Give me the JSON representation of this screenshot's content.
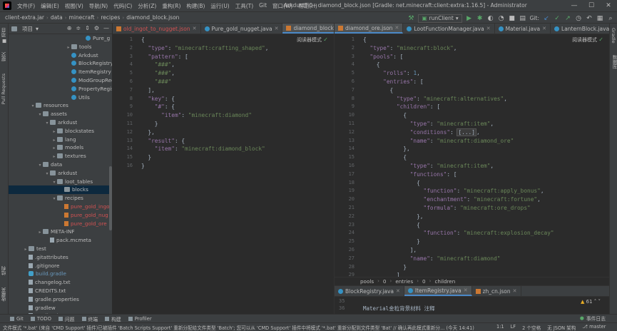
{
  "menu": [
    "文件(F)",
    "编辑(E)",
    "视图(V)",
    "导航(N)",
    "代码(C)",
    "分析(Z)",
    "重构(R)",
    "构建(B)",
    "运行(U)",
    "工具(T)",
    "Git",
    "窗口(W)",
    "帮助(H)"
  ],
  "window_title": "ArkdustTi0 - diamond_block.json [Gradle: net.minecraft:client:extra:1.16.5] - Administrator",
  "breadcrumb": [
    "client-extra.jar",
    "data",
    "minecraft",
    "recipes",
    "diamond_block.json"
  ],
  "run_config": "runClient",
  "git_label": "Git:",
  "project": {
    "title": "项目",
    "rows": [
      {
        "indent": 10,
        "arrow": "",
        "icon": "class",
        "label": "Pure_g",
        "style": ""
      },
      {
        "indent": 8,
        "arrow": "▸",
        "icon": "folder",
        "label": "tools",
        "style": ""
      },
      {
        "indent": 8,
        "arrow": "",
        "icon": "class",
        "label": "Arkdust",
        "style": ""
      },
      {
        "indent": 8,
        "arrow": "",
        "icon": "class",
        "label": "BlockRegistry",
        "style": ""
      },
      {
        "indent": 8,
        "arrow": "",
        "icon": "class",
        "label": "ItemRegistry",
        "style": ""
      },
      {
        "indent": 8,
        "arrow": "",
        "icon": "class",
        "label": "ModGroupRegi",
        "style": ""
      },
      {
        "indent": 8,
        "arrow": "",
        "icon": "class",
        "label": "PropertyRegist",
        "style": ""
      },
      {
        "indent": 8,
        "arrow": "",
        "icon": "class",
        "label": "Utils",
        "style": ""
      },
      {
        "indent": 3,
        "arrow": "▾",
        "icon": "folder",
        "label": "resources",
        "style": ""
      },
      {
        "indent": 4,
        "arrow": "▾",
        "icon": "folder",
        "label": "assets",
        "style": ""
      },
      {
        "indent": 5,
        "arrow": "▾",
        "icon": "folder",
        "label": "arkdust",
        "style": ""
      },
      {
        "indent": 6,
        "arrow": "▸",
        "icon": "folder",
        "label": "blockstates",
        "style": ""
      },
      {
        "indent": 6,
        "arrow": "▸",
        "icon": "folder",
        "label": "lang",
        "style": ""
      },
      {
        "indent": 6,
        "arrow": "▸",
        "icon": "folder",
        "label": "models",
        "style": ""
      },
      {
        "indent": 6,
        "arrow": "▸",
        "icon": "folder",
        "label": "textures",
        "style": ""
      },
      {
        "indent": 4,
        "arrow": "▾",
        "icon": "folder",
        "label": "data",
        "style": ""
      },
      {
        "indent": 5,
        "arrow": "▾",
        "icon": "folder",
        "label": "arkdust",
        "style": ""
      },
      {
        "indent": 6,
        "arrow": "▾",
        "icon": "folder",
        "label": "loot_tables",
        "style": ""
      },
      {
        "indent": 7,
        "arrow": "",
        "icon": "folder",
        "label": "blocks",
        "style": "sel"
      },
      {
        "indent": 6,
        "arrow": "▾",
        "icon": "folder",
        "label": "recipes",
        "style": ""
      },
      {
        "indent": 7,
        "arrow": "",
        "icon": "json",
        "label": "pure_gold_ingo",
        "style": "red"
      },
      {
        "indent": 7,
        "arrow": "",
        "icon": "json",
        "label": "pure_gold_nug",
        "style": "red"
      },
      {
        "indent": 7,
        "arrow": "",
        "icon": "json",
        "label": "pure_gold_ore",
        "style": "red"
      },
      {
        "indent": 4,
        "arrow": "▸",
        "icon": "folder",
        "label": "META-INF",
        "style": ""
      },
      {
        "indent": 5,
        "arrow": "",
        "icon": "file",
        "label": "pack.mcmeta",
        "style": ""
      },
      {
        "indent": 2,
        "arrow": "▸",
        "icon": "folder",
        "label": "test",
        "style": ""
      },
      {
        "indent": 2,
        "arrow": "",
        "icon": "file",
        "label": ".gitattributes",
        "style": ""
      },
      {
        "indent": 2,
        "arrow": "",
        "icon": "file",
        "label": ".gitignore",
        "style": ""
      },
      {
        "indent": 2,
        "arrow": "",
        "icon": "gradle",
        "label": "build.gradle",
        "style": "blue"
      },
      {
        "indent": 2,
        "arrow": "",
        "icon": "file",
        "label": "changelog.txt",
        "style": ""
      },
      {
        "indent": 2,
        "arrow": "",
        "icon": "file",
        "label": "CREDITS.txt",
        "style": ""
      },
      {
        "indent": 2,
        "arrow": "",
        "icon": "file",
        "label": "gradle.properties",
        "style": ""
      },
      {
        "indent": 2,
        "arrow": "",
        "icon": "file",
        "label": "gradlew",
        "style": ""
      },
      {
        "indent": 2,
        "arrow": "",
        "icon": "file",
        "label": "gradlew.bat",
        "style": ""
      },
      {
        "indent": 2,
        "arrow": "",
        "icon": "file",
        "label": "LICENSE.txt",
        "style": ""
      }
    ]
  },
  "left_editor": {
    "tabs": [
      {
        "label": "old_ingot_to_nugget.json",
        "icon": "j",
        "active": false,
        "red": true
      },
      {
        "label": "Pure_gold_nugget.java",
        "icon": "c",
        "active": false,
        "red": false
      },
      {
        "label": "diamond_block.json",
        "icon": "j",
        "active": true,
        "red": false
      }
    ],
    "reader_mode": "阅读器模式",
    "lines": [
      "{",
      "  \"type\": \"minecraft:crafting_shaped\",",
      "  \"pattern\": [",
      "    \"###\",",
      "    \"###\",",
      "    \"###\"",
      "  ],",
      "  \"key\": {",
      "    \"#\": {",
      "      \"item\": \"minecraft:diamond\"",
      "    }",
      "  },",
      "  \"result\": {",
      "    \"item\": \"minecraft:diamond_block\"",
      "  }",
      "}"
    ]
  },
  "right_editor": {
    "tabs": [
      {
        "label": "diamond_ore.json",
        "icon": "j",
        "active": true
      },
      {
        "label": "LootFunctionManager.java",
        "icon": "c",
        "active": false
      },
      {
        "label": "Material.java",
        "icon": "c",
        "active": false
      },
      {
        "label": "LanternBlock.java",
        "icon": "c",
        "active": false
      }
    ],
    "reader_mode": "阅读器模式",
    "line_numbers": [
      "1",
      "2",
      "3",
      "4",
      "5",
      "6",
      "7",
      "8",
      "9",
      "10",
      "11",
      "12",
      "13",
      "14",
      "15",
      "16",
      "17",
      "18",
      "19",
      "20",
      "21",
      "22",
      "23",
      "24",
      "25",
      "26",
      "27",
      "28",
      "29"
    ],
    "lines": [
      "{",
      "  \"type\": \"minecraft:block\",",
      "  \"pools\": [",
      "    {",
      "      \"rolls\": 1,",
      "      \"entries\": [",
      "        {",
      "          \"type\": \"minecraft:alternatives\",",
      "          \"children\": [",
      "            {",
      "              \"type\": \"minecraft:item\",",
      "              \"conditions\": [...],",
      "              \"name\": \"minecraft:diamond_ore\"",
      "            },",
      "            {",
      "              \"type\": \"minecraft:item\",",
      "              \"functions\": [",
      "                {",
      "                  \"function\": \"minecraft:apply_bonus\",",
      "                  \"enchantment\": \"minecraft:fortune\",",
      "                  \"formula\": \"minecraft:ore_drops\"",
      "                },",
      "                {",
      "                  \"function\": \"minecraft:explosion_decay\"",
      "                }",
      "              ],",
      "              \"name\": \"minecraft:diamond\"",
      "            }",
      "          ]"
    ],
    "path_crumbs": [
      "pools",
      "0",
      "entries",
      "0",
      "children"
    ]
  },
  "bottom_editor": {
    "tabs": [
      {
        "label": "BlockRegistry.java",
        "icon": "c",
        "active": false
      },
      {
        "label": "ItemRegistry.java",
        "icon": "c",
        "active": true
      },
      {
        "label": "zh_cn.json",
        "icon": "j",
        "active": false
      }
    ],
    "warnings": "61",
    "line_numbers": [
      "35",
      "36"
    ],
    "line_text": "Material金粒背景材料 注释"
  },
  "bottom_tools": [
    "Git",
    "TODO",
    "问题",
    "终端",
    "构建",
    "Profiler"
  ],
  "event_log": "事件日志",
  "status": {
    "message": "文件模式 '*.bat' (来自 'CMD Support' 插件)已被插件 'Batch Scripts Support' 重新分配给文件类型 'Batch'; 您可以从 'CMD Support' 插件中将模式 '*.bat' 重新分配到文件类型 'Bat' // 确认再此模式重新分... (今天 14:41)",
    "position": "1:1",
    "line_sep": "LF",
    "spaces": "2 个空格",
    "schema": "无 JSON 架构",
    "branch": "master"
  }
}
